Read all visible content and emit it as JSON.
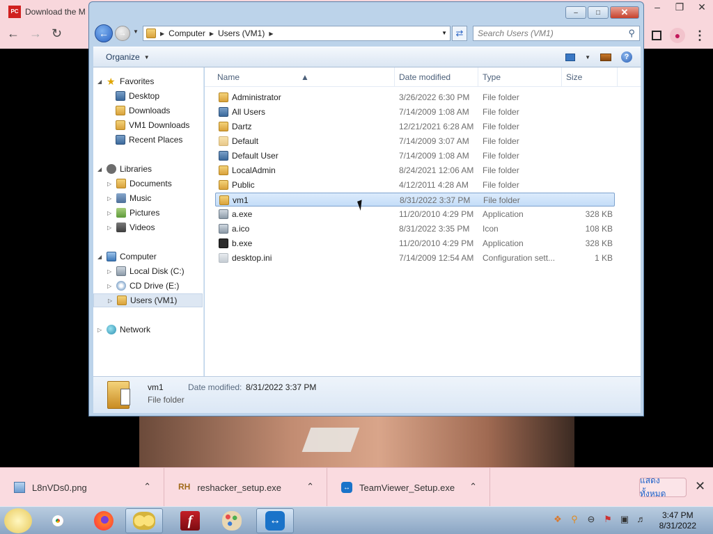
{
  "browser": {
    "tab_title": "Download the M",
    "logo_text": "PC GAMES"
  },
  "window": {
    "breadcrumb": [
      "Computer",
      "Users (VM1)"
    ],
    "search_placeholder": "Search Users (VM1)",
    "organize_label": "Organize"
  },
  "nav": {
    "favorites_label": "Favorites",
    "favorites": [
      {
        "label": "Desktop",
        "icon": "desktop-icon"
      },
      {
        "label": "Downloads",
        "icon": "downloads-icon"
      },
      {
        "label": "VM1 Downloads",
        "icon": "downloads-icon"
      },
      {
        "label": "Recent Places",
        "icon": "recent-places-icon"
      }
    ],
    "libraries_label": "Libraries",
    "libraries": [
      {
        "label": "Documents",
        "icon": "documents-icon"
      },
      {
        "label": "Music",
        "icon": "music-icon"
      },
      {
        "label": "Pictures",
        "icon": "pictures-icon"
      },
      {
        "label": "Videos",
        "icon": "videos-icon"
      }
    ],
    "computer_label": "Computer",
    "computer": [
      {
        "label": "Local Disk (C:)",
        "icon": "disk-icon"
      },
      {
        "label": "CD Drive (E:)",
        "icon": "cd-drive-icon"
      },
      {
        "label": "Users (VM1)",
        "icon": "user-folder-icon",
        "selected": true
      }
    ],
    "network_label": "Network"
  },
  "columns": {
    "name": "Name",
    "date": "Date modified",
    "type": "Type",
    "size": "Size"
  },
  "files": [
    {
      "name": "Administrator",
      "date": "3/26/2022 6:30 PM",
      "type": "File folder",
      "size": "",
      "icon": "folder"
    },
    {
      "name": "All Users",
      "date": "7/14/2009 1:08 AM",
      "type": "File folder",
      "size": "",
      "icon": "folder"
    },
    {
      "name": "Dartz",
      "date": "12/21/2021 6:28 AM",
      "type": "File folder",
      "size": "",
      "icon": "folder"
    },
    {
      "name": "Default",
      "date": "7/14/2009 3:07 AM",
      "type": "File folder",
      "size": "",
      "icon": "folder"
    },
    {
      "name": "Default User",
      "date": "7/14/2009 1:08 AM",
      "type": "File folder",
      "size": "",
      "icon": "folder"
    },
    {
      "name": "LocalAdmin",
      "date": "8/24/2021 12:06 AM",
      "type": "File folder",
      "size": "",
      "icon": "folder"
    },
    {
      "name": "Public",
      "date": "4/12/2011 4:28 AM",
      "type": "File folder",
      "size": "",
      "icon": "folder"
    },
    {
      "name": "vm1",
      "date": "8/31/2022 3:37 PM",
      "type": "File folder",
      "size": "",
      "icon": "folder",
      "selected": true
    },
    {
      "name": "a.exe",
      "date": "11/20/2010 4:29 PM",
      "type": "Application",
      "size": "328 KB",
      "icon": "exe"
    },
    {
      "name": "a.ico",
      "date": "8/31/2022 3:35 PM",
      "type": "Icon",
      "size": "108 KB",
      "icon": "ico"
    },
    {
      "name": "b.exe",
      "date": "11/20/2010 4:29 PM",
      "type": "Application",
      "size": "328 KB",
      "icon": "exe-dark"
    },
    {
      "name": "desktop.ini",
      "date": "7/14/2009 12:54 AM",
      "type": "Configuration sett...",
      "size": "1 KB",
      "icon": "ini"
    }
  ],
  "details": {
    "name": "vm1",
    "type": "File folder",
    "modified_label": "Date modified:",
    "modified_value": "8/31/2022 3:37 PM"
  },
  "downloads": [
    {
      "name": "L8nVDs0.png"
    },
    {
      "name": "reshacker_setup.exe",
      "icon_text": "RH"
    },
    {
      "name": "TeamViewer_Setup.exe"
    }
  ],
  "show_all_label": "แสดงทั้งหมด",
  "clock": {
    "time": "3:47 PM",
    "date": "8/31/2022"
  }
}
